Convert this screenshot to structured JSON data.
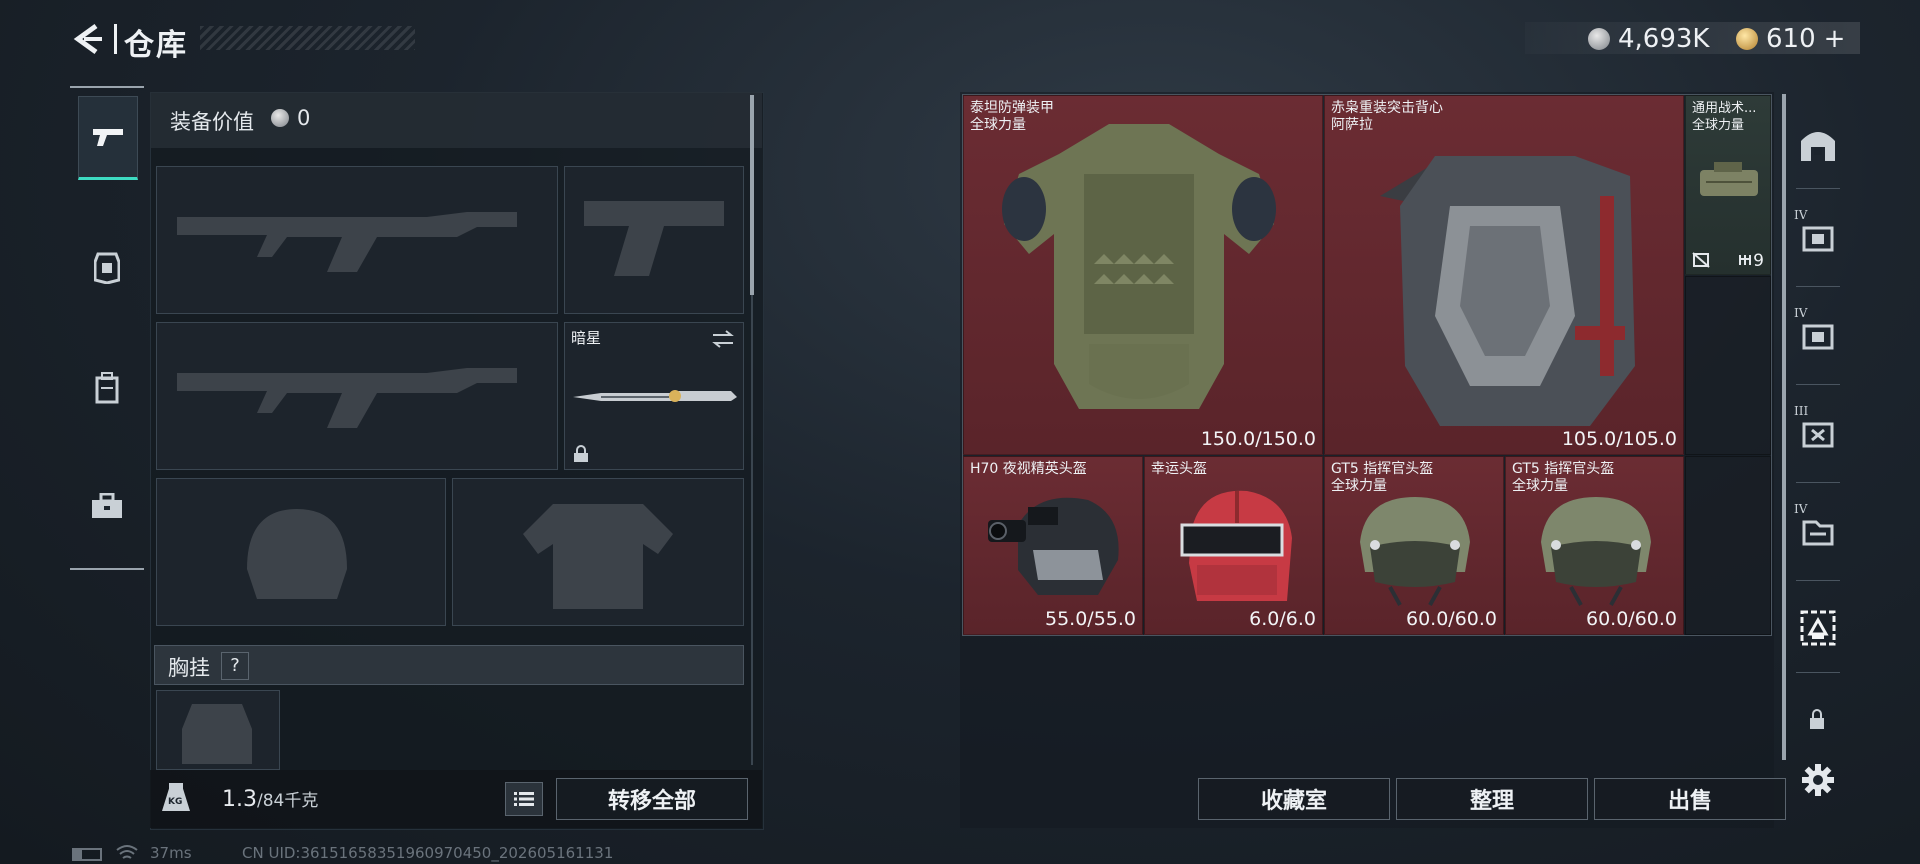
{
  "header": {
    "title": "仓库",
    "currency_silver": "4,693K",
    "currency_gold": "610",
    "plus": "+"
  },
  "left_nav": {
    "items": [
      {
        "name": "weapons",
        "icon": "pistol-icon",
        "active": true
      },
      {
        "name": "armor",
        "icon": "armor-icon",
        "active": false
      },
      {
        "name": "backpack",
        "icon": "backpack-icon",
        "active": false
      },
      {
        "name": "toolbox",
        "icon": "toolbox-icon",
        "active": false
      }
    ]
  },
  "loadout": {
    "equip_value_label": "装备价值",
    "equip_value": "0",
    "melee_name": "暗星",
    "chest_rig_label": "胸挂",
    "help": "?",
    "weight_current": "1.3",
    "weight_max": "/84千克",
    "weight_icon_text": "KG",
    "transfer_all": "转移全部"
  },
  "stash": {
    "items": [
      {
        "name": "泰坦防弹装甲",
        "sub": "全球力量",
        "durability": "150.0/150.0"
      },
      {
        "name": "赤枭重装突击背心",
        "sub": "阿萨拉",
        "durability": "105.0/105.0"
      },
      {
        "name": "通用战术...",
        "sub": "全球力量",
        "count": "9"
      },
      {
        "name": "H70 夜视精英头盔",
        "sub": "",
        "durability": "55.0/55.0"
      },
      {
        "name": "幸运头盔",
        "sub": "",
        "durability": "6.0/6.0"
      },
      {
        "name": "GT5 指挥官头盔",
        "sub": "全球力量",
        "durability": "60.0/60.0"
      },
      {
        "name": "GT5 指挥官头盔",
        "sub": "全球力量",
        "durability": "60.0/60.0"
      }
    ],
    "buttons": {
      "collection": "收藏室",
      "sort": "整理",
      "sell": "出售"
    }
  },
  "right_nav": {
    "tiers": [
      "IV",
      "IV",
      "III",
      "IV"
    ]
  },
  "status_bar": {
    "ping": "37ms",
    "uid": "CN UID:36151658351960970450_202605161131"
  },
  "colors": {
    "accent": "#3ddbc2",
    "cell_red": "#6b2c33",
    "cell_green": "#2e3b38"
  }
}
